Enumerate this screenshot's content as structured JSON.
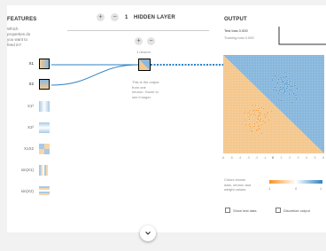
{
  "features": {
    "title": "FEATURES",
    "question": [
      "Which",
      "properties do",
      "you want to",
      "feed in?"
    ],
    "items": [
      {
        "label": "X1",
        "active": true,
        "pattern": "x1"
      },
      {
        "label": "X2",
        "active": true,
        "pattern": "x2"
      },
      {
        "label": "X1²",
        "active": false,
        "pattern": "x1sq"
      },
      {
        "label": "X2²",
        "active": false,
        "pattern": "x2sq"
      },
      {
        "label": "X1X2",
        "active": false,
        "pattern": "x1x2"
      },
      {
        "label": "sin(X1)",
        "active": false,
        "pattern": "sinx1"
      },
      {
        "label": "sin(X2)",
        "active": false,
        "pattern": "sinx2"
      }
    ]
  },
  "hidden": {
    "plus": "+",
    "minus": "−",
    "count": "1",
    "title": "HIDDEN LAYER",
    "neuron_label": "1 neuron",
    "note": [
      "This is the output",
      "from one",
      "neuron. Hover to",
      "see it larger."
    ]
  },
  "output": {
    "title": "OUTPUT",
    "test_loss": "Test loss 0.000",
    "training_loss": "Training loss 0.000",
    "axis_ticks": [
      "-6",
      "-5",
      "-4",
      "-3",
      "-2",
      "-1",
      "0",
      "1",
      "2",
      "3",
      "4",
      "5",
      "6"
    ],
    "legend_text": [
      "Colors shows",
      "data, neuron and",
      "weight values."
    ],
    "legend_ticks": [
      "-1",
      "0",
      "1"
    ],
    "show_test_data": "Show test data",
    "discretize": "Discretize output"
  },
  "colors": {
    "positive": "#2e82c4",
    "negative": "#f59322",
    "positive_bg": "#8ab8dd",
    "negative_bg": "#f4c88f"
  },
  "icons": {
    "expand": "chevron-down-icon"
  }
}
